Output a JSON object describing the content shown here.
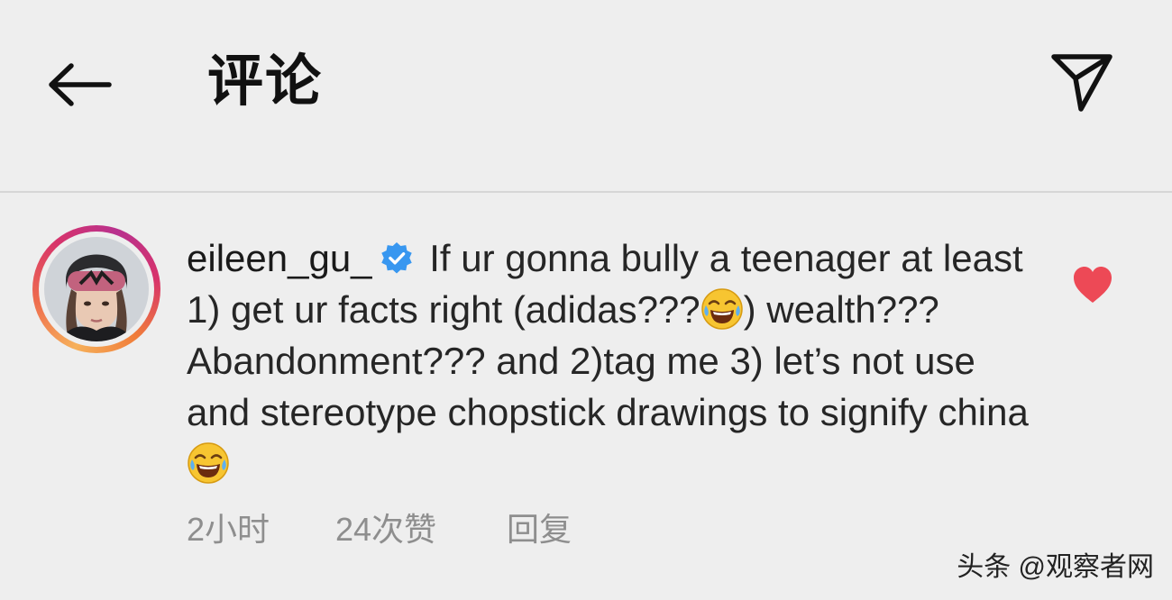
{
  "header": {
    "title": "评论",
    "back_icon": "arrow-left-icon",
    "share_icon": "paper-plane-icon"
  },
  "comment": {
    "username": "eileen_gu_",
    "verified_icon": "verified-badge-icon",
    "text_parts": [
      " If ur gonna bully a teenager at least 1) get ur facts right (adidas???",
      ") wealth??? Abandonment??? and 2)tag me 3) let’s not use and stereotype chopstick drawings to signify china "
    ],
    "emoji_icon": "face-with-tears-of-joy-emoji",
    "time": "2小时",
    "likes": "24次赞",
    "reply_label": "回复",
    "like_icon": "heart-icon",
    "liked": true
  },
  "watermark": "头条 @观察者网",
  "colors": {
    "background": "#eeeeee",
    "verified": "#3897f0",
    "heart": "#ed4956",
    "meta_text": "#8e8e8e"
  }
}
